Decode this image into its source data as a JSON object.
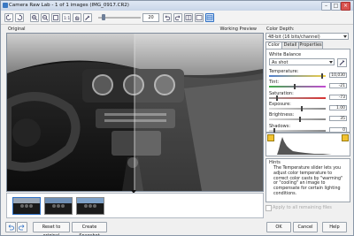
{
  "window": {
    "title": "Camera Raw Lab - 1 of 1 images (IMG_0917.CR2)",
    "controls": {
      "minimize": "–",
      "maximize": "□",
      "close": "×"
    }
  },
  "toolbar": {
    "zoom_value": "20",
    "icons": [
      "rotate-left-icon",
      "rotate-right-icon",
      "zoom-in-icon",
      "zoom-out-icon",
      "fit-icon",
      "actual-size-icon",
      "hand-icon",
      "eyedropper-icon",
      "undo-icon",
      "redo-icon",
      "single-view-icon",
      "split-view-vertical-icon",
      "split-view-horizontal-icon"
    ]
  },
  "preview": {
    "left_label": "Original",
    "right_label": "Working Preview"
  },
  "filmstrip": {
    "thumbnail_count": 3,
    "selected_index": 0
  },
  "bottom_bar": {
    "reset_label": "Reset to original",
    "snapshot_label": "Create Snapshot",
    "ok_label": "OK",
    "cancel_label": "Cancel",
    "help_label": "Help"
  },
  "side_panel": {
    "color_depth_label": "Color Depth:",
    "color_depth_value": "48-bit (16 bits/channel)",
    "tabs": [
      "Color",
      "Detail",
      "Properties"
    ],
    "active_tab": "Color",
    "white_balance_label": "White Balance",
    "white_balance_value": "As shot",
    "sliders": [
      {
        "label": "Temperature:",
        "value": "10,030",
        "position": 0.93,
        "track": "temperature"
      },
      {
        "label": "Tint:",
        "value": "-21",
        "position": 0.45,
        "track": "tint"
      },
      {
        "label": "Saturation:",
        "value": "-73",
        "position": 0.14,
        "track": "saturation"
      },
      {
        "label": "Exposure:",
        "value": "1.00",
        "position": 0.58,
        "track": "gray"
      },
      {
        "label": "Brightness:",
        "value": "35",
        "position": 0.55,
        "track": "gray"
      },
      {
        "label": "Shadows:",
        "value": "0",
        "position": 0.1,
        "track": "gray"
      }
    ],
    "hints_title": "Hints",
    "hints_text": "The Temperature slider lets you adjust color temperature to correct color casts by \"warming\" or \"cooling\" an image to compensate for certain lighting conditions.",
    "apply_all_label": "Apply to all remaining files"
  },
  "colors": {
    "accent": "#2d6fc4",
    "warning": "#f2c230",
    "window_border": "#8a97a8"
  }
}
